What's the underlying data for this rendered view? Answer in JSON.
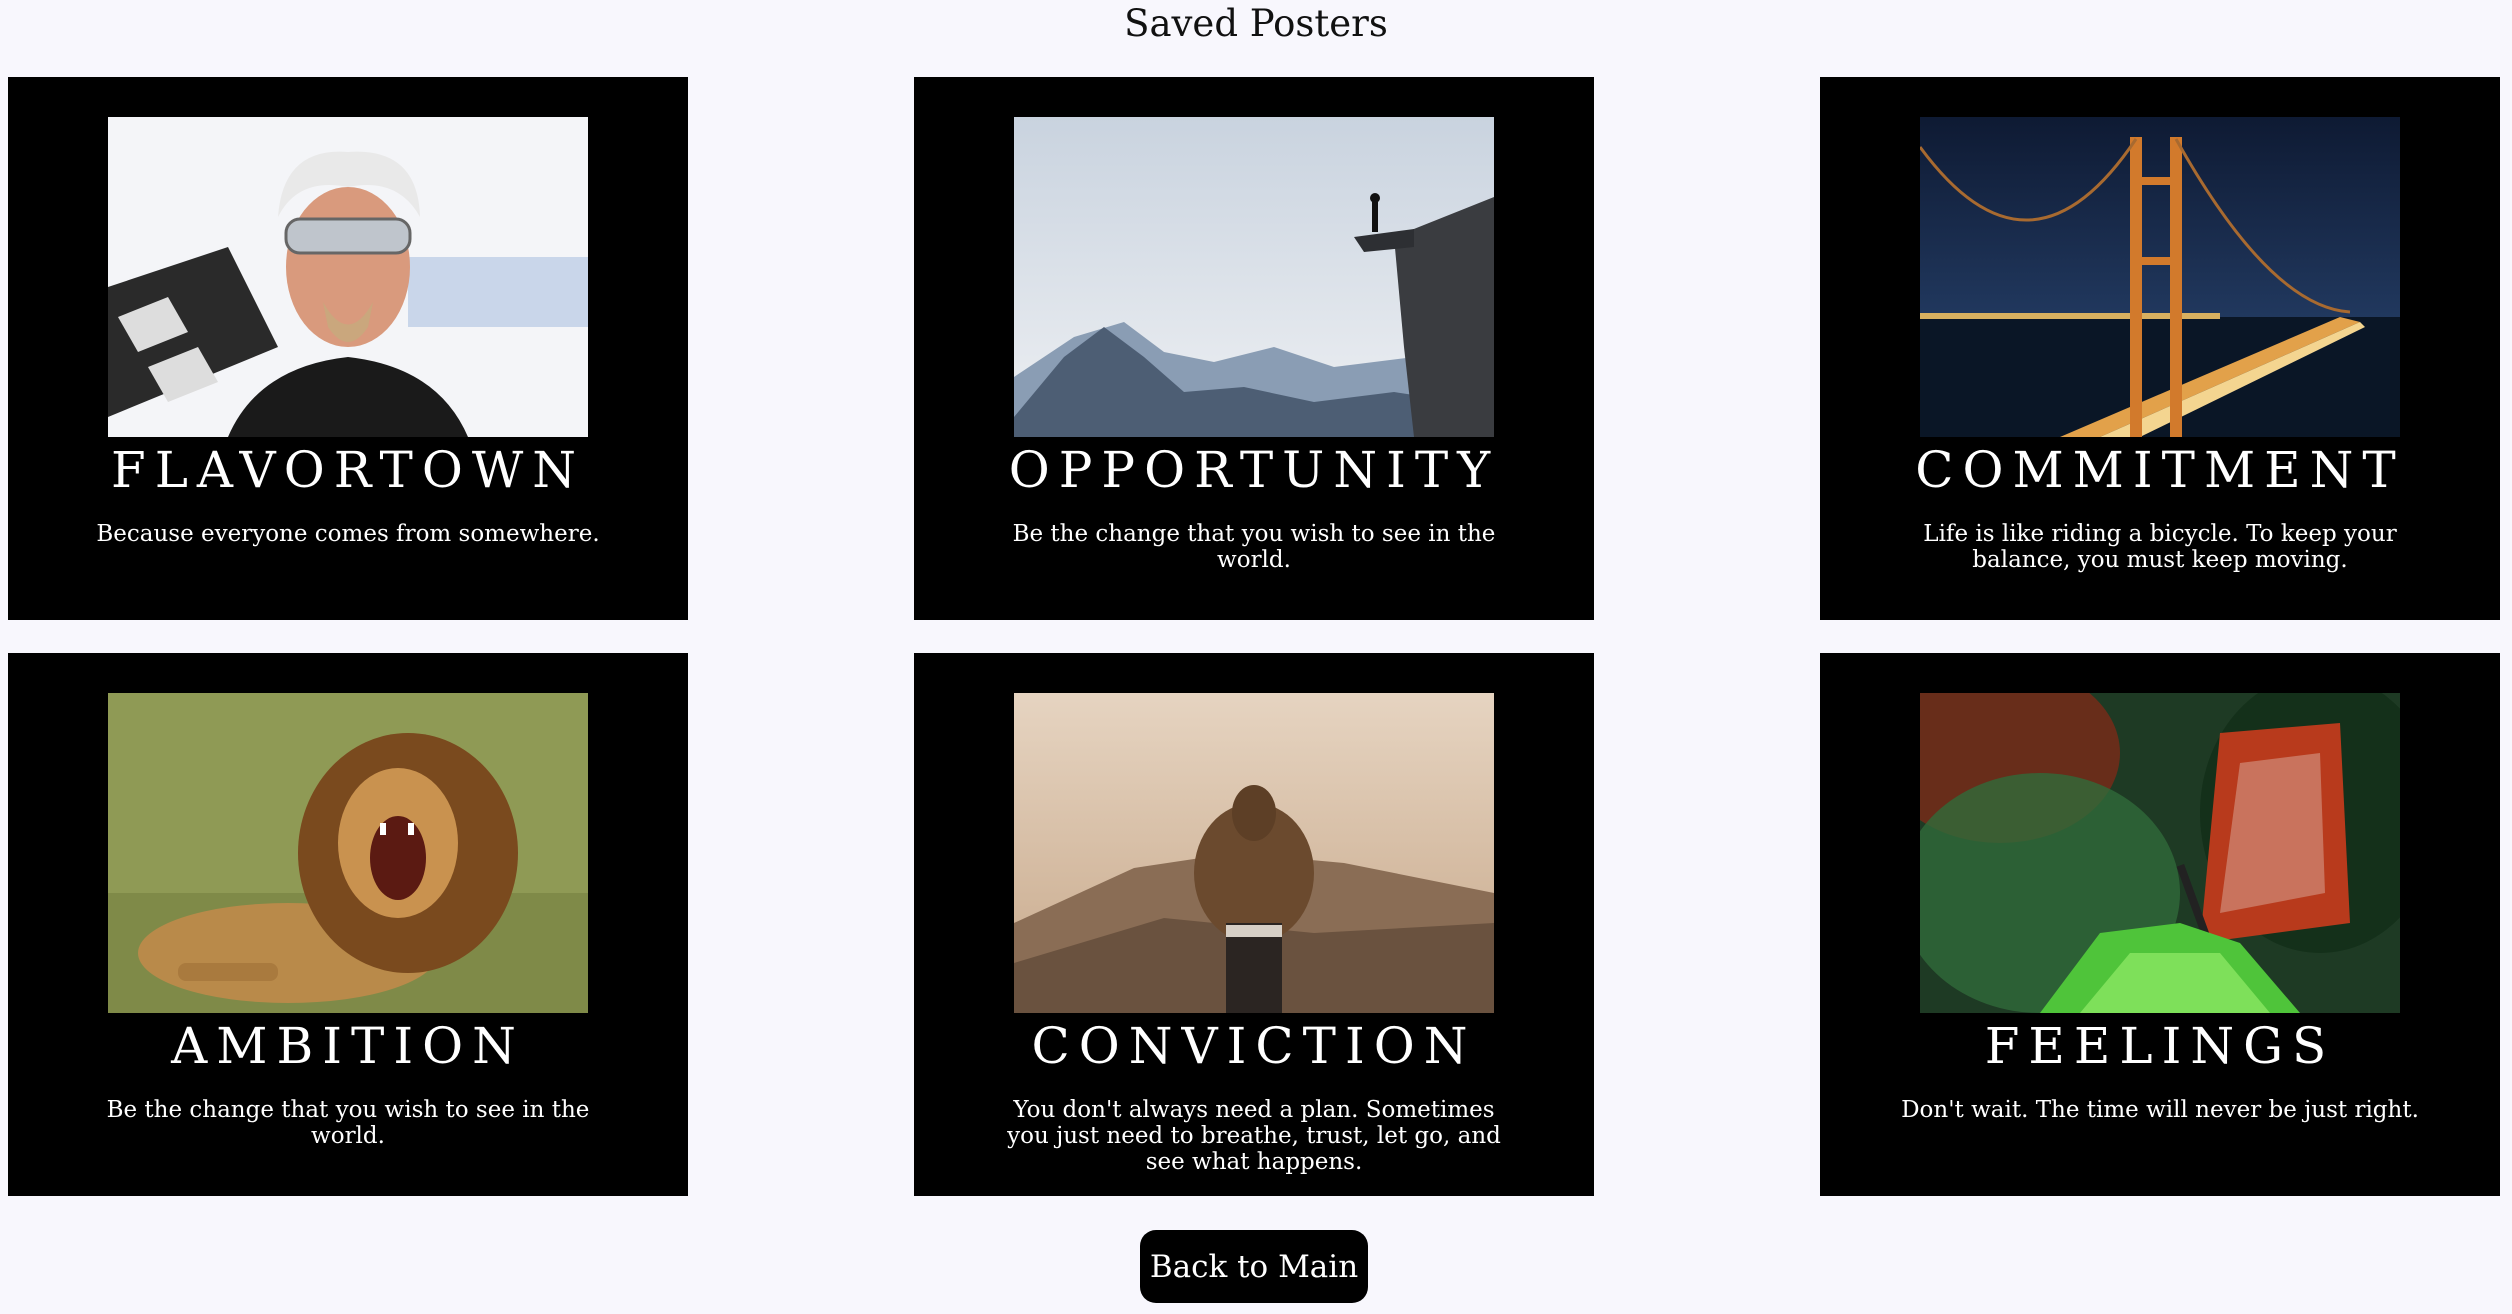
{
  "page": {
    "title": "Saved Posters"
  },
  "posters": [
    {
      "title": "FLAVORTOWN",
      "quote": "Because everyone comes from somewhere.",
      "image": "man-with-sunglasses-photo"
    },
    {
      "title": "OPPORTUNITY",
      "quote": "Be the change that you wish to see in the world.",
      "image": "person-on-cliff-photo"
    },
    {
      "title": "COMMITMENT",
      "quote": "Life is like riding a bicycle. To keep your balance, you must keep moving.",
      "image": "golden-gate-bridge-night-photo"
    },
    {
      "title": "AMBITION",
      "quote": "Be the change that you wish to see in the world.",
      "image": "roaring-lion-photo"
    },
    {
      "title": "CONVICTION",
      "quote": "You don't always need a plan. Sometimes you just need to breathe, trust, let go, and see what happens.",
      "image": "hooded-person-mountains-photo"
    },
    {
      "title": "FEELINGS",
      "quote": "Don't wait. The time will never be just right.",
      "image": "butterfly-on-fern-photo"
    }
  ],
  "actions": {
    "back_label": "Back to Main"
  }
}
